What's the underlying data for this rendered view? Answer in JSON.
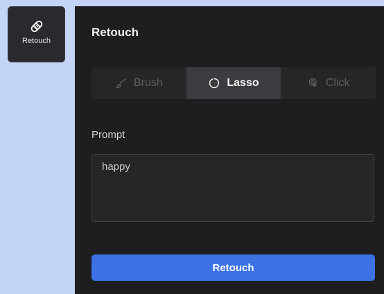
{
  "toolbar": {
    "retouch_button": {
      "label": "Retouch",
      "icon": "bandage-icon"
    }
  },
  "panel": {
    "title": "Retouch",
    "modes": [
      {
        "label": "Brush",
        "icon": "brush-icon",
        "selected": false
      },
      {
        "label": "Lasso",
        "icon": "lasso-icon",
        "selected": true
      },
      {
        "label": "Click",
        "icon": "click-icon",
        "selected": false
      }
    ],
    "prompt": {
      "label": "Prompt",
      "value": "happy"
    },
    "submit_label": "Retouch"
  },
  "colors": {
    "page_background": "#c4d4f7",
    "panel_background": "#1e1e20",
    "accent": "#3c72e4"
  }
}
